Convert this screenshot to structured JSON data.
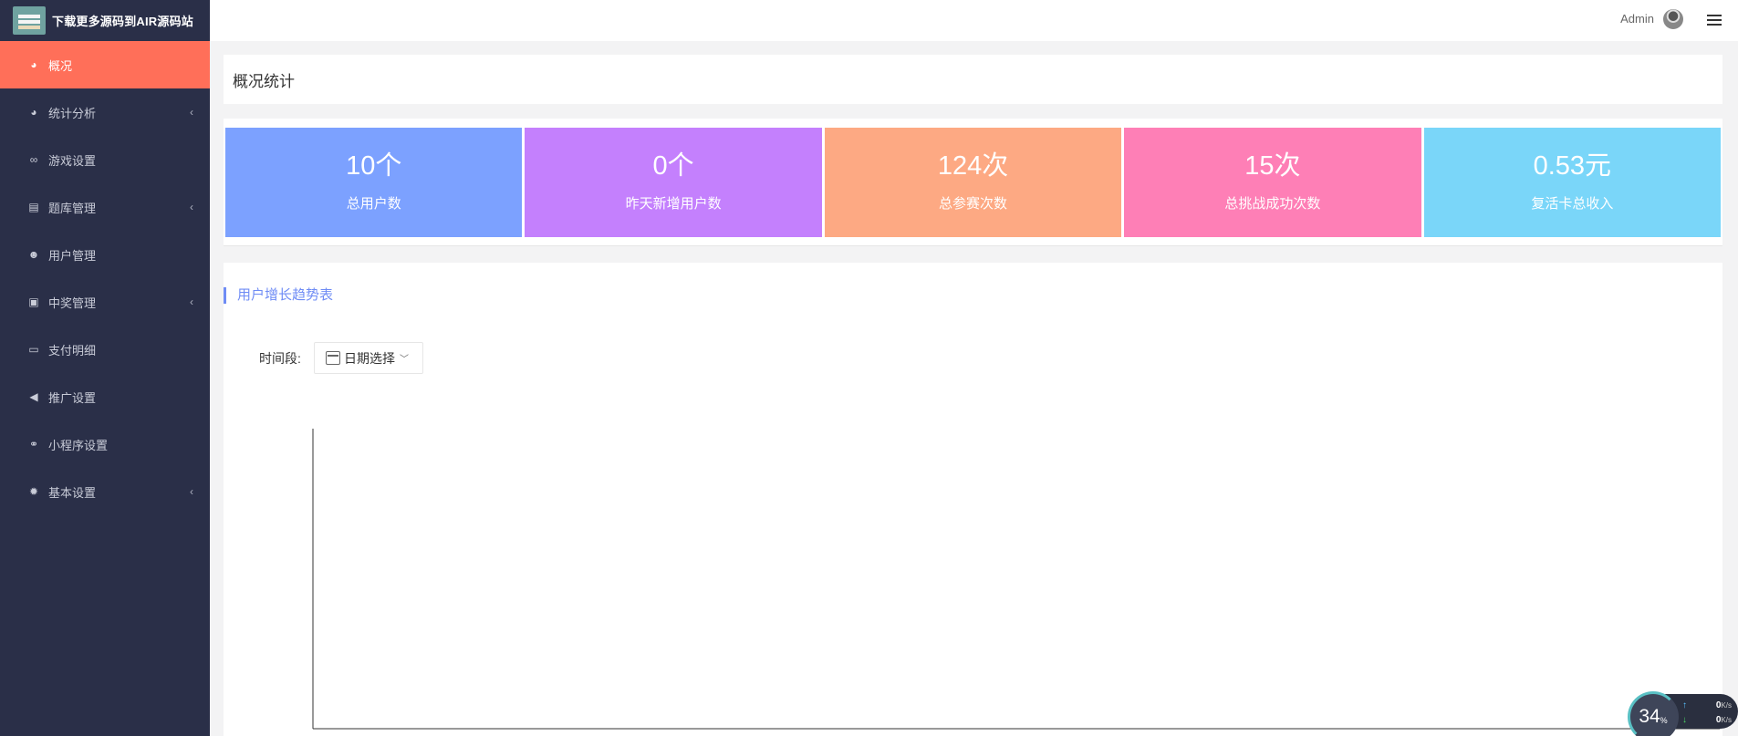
{
  "brand": {
    "title": "下载更多源码到AIR源码站"
  },
  "sidebar": {
    "items": [
      {
        "label": "概况",
        "icon": "pie-chart-icon",
        "has_arrow": false,
        "active": true
      },
      {
        "label": "统计分析",
        "icon": "pie-chart-icon",
        "has_arrow": true
      },
      {
        "label": "游戏设置",
        "icon": "gamepad-icon",
        "has_arrow": false
      },
      {
        "label": "题库管理",
        "icon": "list-icon",
        "has_arrow": true
      },
      {
        "label": "用户管理",
        "icon": "user-circle-icon",
        "has_arrow": false
      },
      {
        "label": "中奖管理",
        "icon": "badge-icon",
        "has_arrow": true
      },
      {
        "label": "支付明细",
        "icon": "credit-card-icon",
        "has_arrow": false
      },
      {
        "label": "推广设置",
        "icon": "megaphone-icon",
        "has_arrow": false
      },
      {
        "label": "小程序设置",
        "icon": "link-icon",
        "has_arrow": false
      },
      {
        "label": "基本设置",
        "icon": "gear-icon",
        "has_arrow": true
      }
    ]
  },
  "topbar": {
    "user": "Admin"
  },
  "overview": {
    "title": "概况统计"
  },
  "stats": [
    {
      "value": "10个",
      "label": "总用户数",
      "color": "#7ca1ff"
    },
    {
      "value": "0个",
      "label": "昨天新增用户数",
      "color": "#c480fd"
    },
    {
      "value": "124次",
      "label": "总参赛次数",
      "color": "#fda983"
    },
    {
      "value": "15次",
      "label": "总挑战成功次数",
      "color": "#fe7fb6"
    },
    {
      "value": "0.53元",
      "label": "复活卡总收入",
      "color": "#7ad6f9"
    }
  ],
  "chart_section": {
    "title": "用户增长趋势表",
    "time_label": "时间段:",
    "date_picker_placeholder": "日期选择"
  },
  "chart_data": {
    "type": "line",
    "title": "",
    "xlabel": "",
    "ylabel": "",
    "x": [],
    "series": []
  },
  "net_widget": {
    "percent": "34",
    "percent_unit": "%",
    "up": "0",
    "down": "0",
    "unit": "K/s"
  },
  "colors": {
    "sidebar_bg": "#2a2f48",
    "active": "#ff6f59",
    "accent": "#6f8cf5"
  }
}
